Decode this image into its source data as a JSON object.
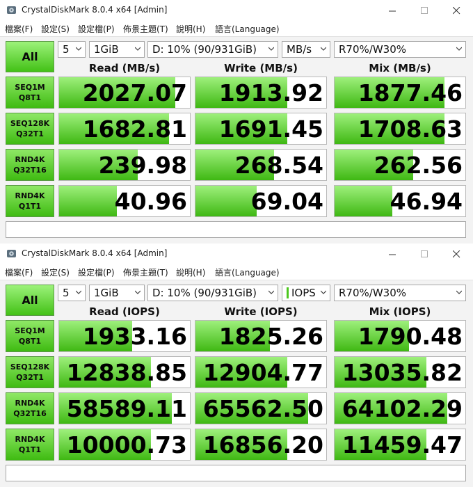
{
  "windows": [
    {
      "title": "CrystalDiskMark 8.0.4 x64 [Admin]",
      "menu": [
        "檔案(F)",
        "設定(S)",
        "設定檔(P)",
        "佈景主題(T)",
        "說明(H)",
        "語言(Language)"
      ],
      "all_label": "All",
      "combos": {
        "count": "5",
        "size": "1GiB",
        "drive": "D: 10% (90/931GiB)",
        "units": "MB/s",
        "mix": "R70%/W30%"
      },
      "columns": [
        "Read (MB/s)",
        "Write (MB/s)",
        "Mix (MB/s)"
      ],
      "rows": [
        {
          "l1": "SEQ1M",
          "l2": "Q8T1",
          "vals": [
            "2027.07",
            "1913.92",
            "1877.46"
          ],
          "fill": [
            0.89,
            0.7,
            0.84
          ]
        },
        {
          "l1": "SEQ128K",
          "l2": "Q32T1",
          "vals": [
            "1682.81",
            "1691.45",
            "1708.63"
          ],
          "fill": [
            0.84,
            0.7,
            0.84
          ]
        },
        {
          "l1": "RND4K",
          "l2": "Q32T16",
          "vals": [
            "239.98",
            "268.54",
            "262.56"
          ],
          "fill": [
            0.6,
            0.6,
            0.6
          ]
        },
        {
          "l1": "RND4K",
          "l2": "Q1T1",
          "vals": [
            "40.96",
            "69.04",
            "46.94"
          ],
          "fill": [
            0.44,
            0.47,
            0.44
          ]
        }
      ]
    },
    {
      "title": "CrystalDiskMark 8.0.4 x64 [Admin]",
      "menu": [
        "檔案(F)",
        "設定(S)",
        "設定檔(P)",
        "佈景主題(T)",
        "說明(H)",
        "語言(Language)"
      ],
      "all_label": "All",
      "combos": {
        "count": "5",
        "size": "1GiB",
        "drive": "D: 10% (90/931GiB)",
        "units": "IOPS",
        "mix": "R70%/W30%"
      },
      "columns": [
        "Read (IOPS)",
        "Write (IOPS)",
        "Mix (IOPS)"
      ],
      "rows": [
        {
          "l1": "SEQ1M",
          "l2": "Q8T1",
          "vals": [
            "1933.16",
            "1825.26",
            "1790.48"
          ],
          "fill": [
            0.56,
            0.57,
            0.57
          ]
        },
        {
          "l1": "SEQ128K",
          "l2": "Q32T1",
          "vals": [
            "12838.85",
            "12904.77",
            "13035.82"
          ],
          "fill": [
            0.7,
            0.7,
            0.7
          ]
        },
        {
          "l1": "RND4K",
          "l2": "Q32T16",
          "vals": [
            "58589.11",
            "65562.50",
            "64102.29"
          ],
          "fill": [
            0.86,
            0.86,
            0.86
          ]
        },
        {
          "l1": "RND4K",
          "l2": "Q1T1",
          "vals": [
            "10000.73",
            "16856.20",
            "11459.47"
          ],
          "fill": [
            0.7,
            0.7,
            0.7
          ]
        }
      ]
    }
  ]
}
